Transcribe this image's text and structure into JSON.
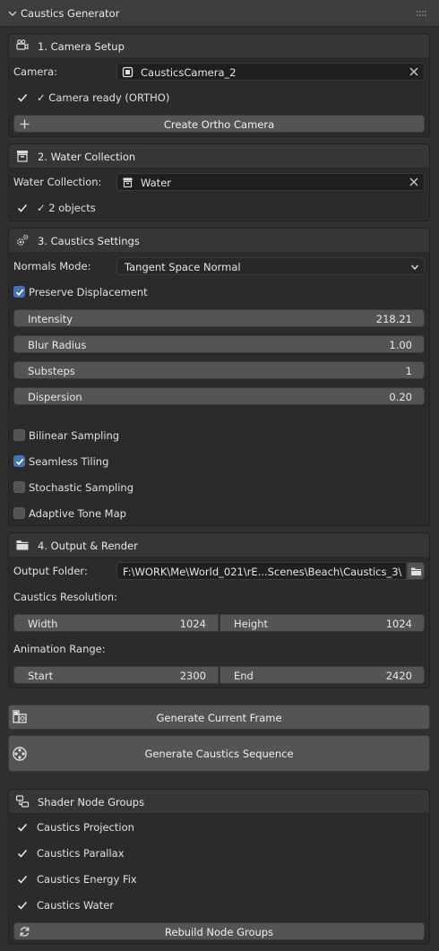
{
  "panel": {
    "title": "Caustics Generator"
  },
  "camera_setup": {
    "header": "1. Camera Setup",
    "camera_label": "Camera:",
    "camera_value": "CausticsCamera_2",
    "status": "✓ Camera ready (ORTHO)",
    "create_button": "Create Ortho Camera"
  },
  "water_collection": {
    "header": "2. Water Collection",
    "label": "Water Collection:",
    "value": "Water",
    "status": "✓ 2 objects"
  },
  "caustics_settings": {
    "header": "3. Caustics Settings",
    "normals_label": "Normals Mode:",
    "normals_value": "Tangent Space Normal",
    "preserve_displacement": {
      "label": "Preserve Displacement",
      "checked": true
    },
    "sliders": [
      {
        "label": "Intensity",
        "value": "218.21"
      },
      {
        "label": "Blur Radius",
        "value": "1.00"
      },
      {
        "label": "Substeps",
        "value": "1"
      },
      {
        "label": "Dispersion",
        "value": "0.20"
      }
    ],
    "options": [
      {
        "label": "Bilinear Sampling",
        "checked": false
      },
      {
        "label": "Seamless Tiling",
        "checked": true
      },
      {
        "label": "Stochastic Sampling",
        "checked": false
      },
      {
        "label": "Adaptive Tone Map",
        "checked": false
      }
    ]
  },
  "output_render": {
    "header": "4. Output & Render",
    "folder_label": "Output Folder:",
    "folder_value": "F:\\WORK\\Me\\World_021\\rE...Scenes\\Beach\\Caustics_3\\",
    "resolution_label": "Caustics Resolution:",
    "width_label": "Width",
    "width_value": "1024",
    "height_label": "Height",
    "height_value": "1024",
    "animation_label": "Animation Range:",
    "start_label": "Start",
    "start_value": "2300",
    "end_label": "End",
    "end_value": "2420"
  },
  "actions": {
    "generate_frame": "Generate Current Frame",
    "generate_sequence": "Generate Caustics Sequence"
  },
  "shader_groups": {
    "header": "Shader Node Groups",
    "items": [
      "Caustics Projection",
      "Caustics Parallax",
      "Caustics Energy Fix",
      "Caustics Water"
    ],
    "rebuild_button": "Rebuild Node Groups"
  },
  "colors": {
    "accent": "#4772b3",
    "button": "#545454",
    "field": "#1f1f1f",
    "panel": "#2b2b2b"
  }
}
